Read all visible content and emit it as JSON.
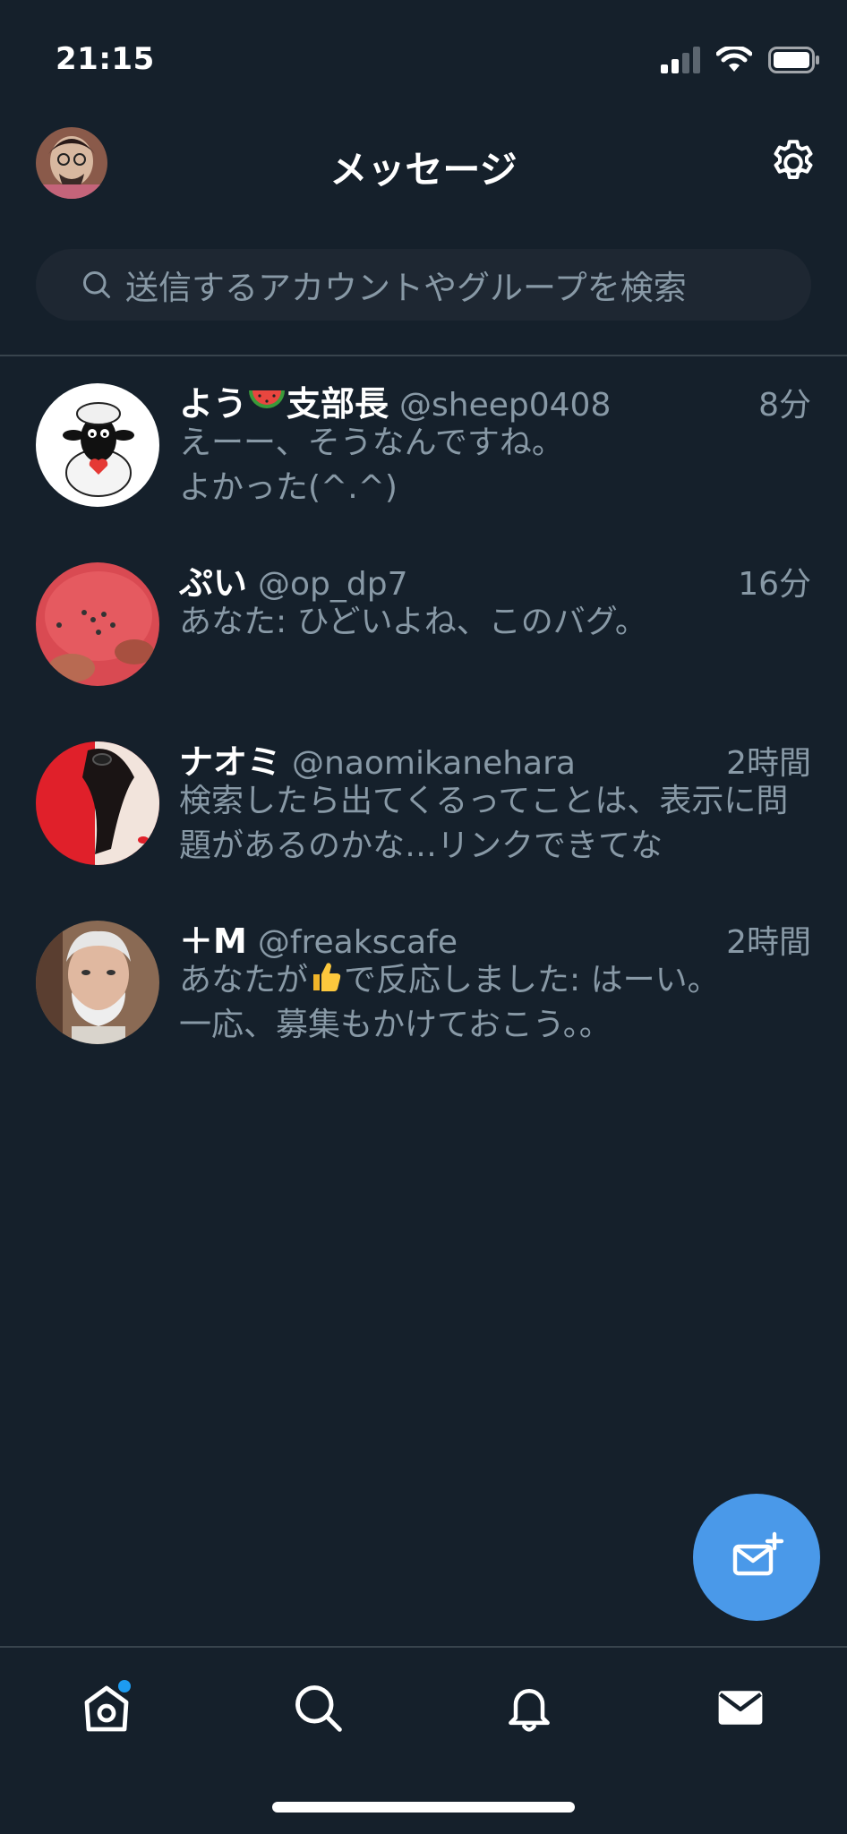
{
  "status_bar": {
    "time": "21:15"
  },
  "header": {
    "title": "メッセージ"
  },
  "search": {
    "placeholder": "送信するアカウントやグループを検索"
  },
  "conversations": [
    {
      "name_pre": "よう",
      "name_emoji": "watermelon-emoji",
      "name_post": "支部長",
      "handle": "@sheep0408",
      "time": "8分",
      "message": "えーー、そうなんですね。\nよかった(^.^)"
    },
    {
      "name": "ぷい",
      "handle": "@op_dp7",
      "time": "16分",
      "message": "あなた: ひどいよね、このバグ。"
    },
    {
      "name": "ナオミ",
      "handle": "@naomikanehara",
      "time": "2時間",
      "message": "検索したら出てくるってことは、表示に問題があるのかな…リンクできてな"
    },
    {
      "name": "＋M",
      "handle": "@freakscafe",
      "time": "2時間",
      "message_pre": "あなたが",
      "message_emoji": "thumbs-up-emoji",
      "message_post": "で反応しました: はーい。\n一応、募集もかけておこう。。"
    }
  ],
  "tabs": [
    "home-icon",
    "search-icon",
    "notifications-icon",
    "messages-icon"
  ],
  "colors": {
    "background": "#15202b",
    "accent": "#4a99e9",
    "secondary_text": "#8899a6"
  }
}
